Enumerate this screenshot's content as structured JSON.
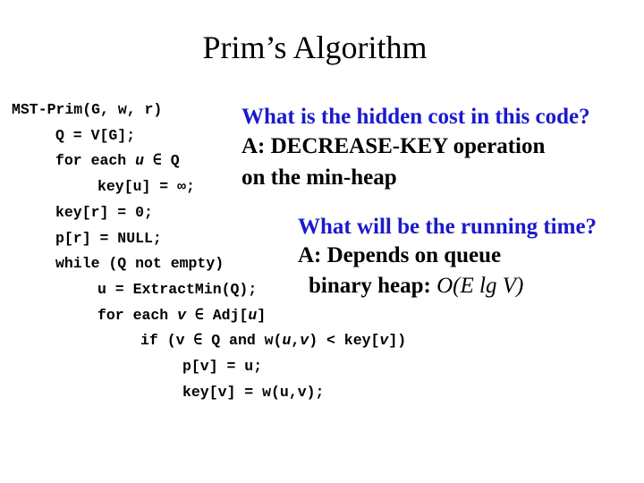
{
  "slide": {
    "title": "Prim’s Algorithm",
    "code_lines": [
      {
        "segments": [
          {
            "t": "MST-Prim(G, w, r)"
          }
        ]
      },
      {
        "segments": [
          {
            "t": "Q = V[G];"
          }
        ]
      },
      {
        "segments": [
          {
            "t": "for each "
          },
          {
            "t": "u",
            "i": true
          },
          {
            "t": " ∈ Q"
          }
        ]
      },
      {
        "segments": [
          {
            "t": "key[u] = ∞;"
          }
        ]
      },
      {
        "segments": [
          {
            "t": "key[r] = 0;"
          }
        ]
      },
      {
        "segments": [
          {
            "t": "p[r] = NULL;"
          }
        ]
      },
      {
        "segments": [
          {
            "t": "while (Q not empty)"
          }
        ]
      },
      {
        "segments": [
          {
            "t": "u = ExtractMin(Q);"
          }
        ]
      },
      {
        "segments": [
          {
            "t": "for each "
          },
          {
            "t": "v",
            "i": true
          },
          {
            "t": " ∈ Adj["
          },
          {
            "t": "u",
            "i": true
          },
          {
            "t": "]"
          }
        ]
      },
      {
        "segments": [
          {
            "t": "if (v ∈ Q and w("
          },
          {
            "t": "u",
            "i": true
          },
          {
            "t": ","
          },
          {
            "t": "v",
            "i": true
          },
          {
            "t": ") < key["
          },
          {
            "t": "v",
            "i": true
          },
          {
            "t": "])"
          }
        ]
      },
      {
        "segments": [
          {
            "t": "p[v] = u;"
          }
        ]
      },
      {
        "segments": [
          {
            "t": "key[v] = w(u,v);"
          }
        ]
      }
    ],
    "question1": "What is the hidden cost in this code?",
    "answer1_line1": "A: DECREASE-KEY operation",
    "answer1_line2": "on the min-heap",
    "question2": "What will be the running time?",
    "answer2_line1": "A: Depends on queue",
    "answer2_line2_prefix": "binary heap: ",
    "answer2_line2_math": "O(E lg V)",
    "colors": {
      "question": "#1a1acc",
      "text": "#000000"
    }
  }
}
